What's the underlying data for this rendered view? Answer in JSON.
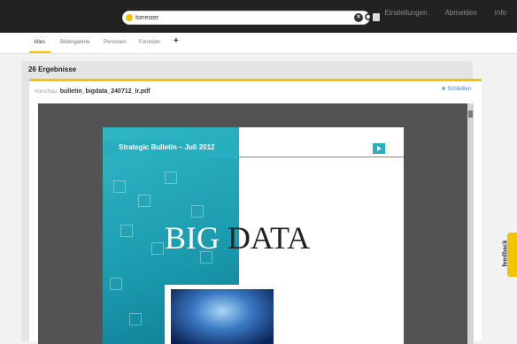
{
  "topbar": {
    "search": {
      "value": "forrester"
    },
    "links": [
      "Einstellungen",
      "Abmelden",
      "Info"
    ]
  },
  "tabs": [
    "Alles",
    "Bildergalerie",
    "Personen",
    "Forrester"
  ],
  "tab_add_label": "+",
  "results": {
    "count_label": "26 Ergebnisse"
  },
  "preview": {
    "label": "Vorschau",
    "filename": "bulletin_bigdata_240712_lr.pdf",
    "close_label": "⊗ Schließen",
    "document": {
      "header": "Strategic Bulletin – Juli 2012",
      "title_part1": "BIG",
      "title_part2": "DATA"
    }
  },
  "feedback": {
    "label": "feedback"
  },
  "colors": {
    "accent": "#f5c400",
    "topbar": "#222222",
    "teal": "#27aebf",
    "link": "#3a7ac0"
  }
}
